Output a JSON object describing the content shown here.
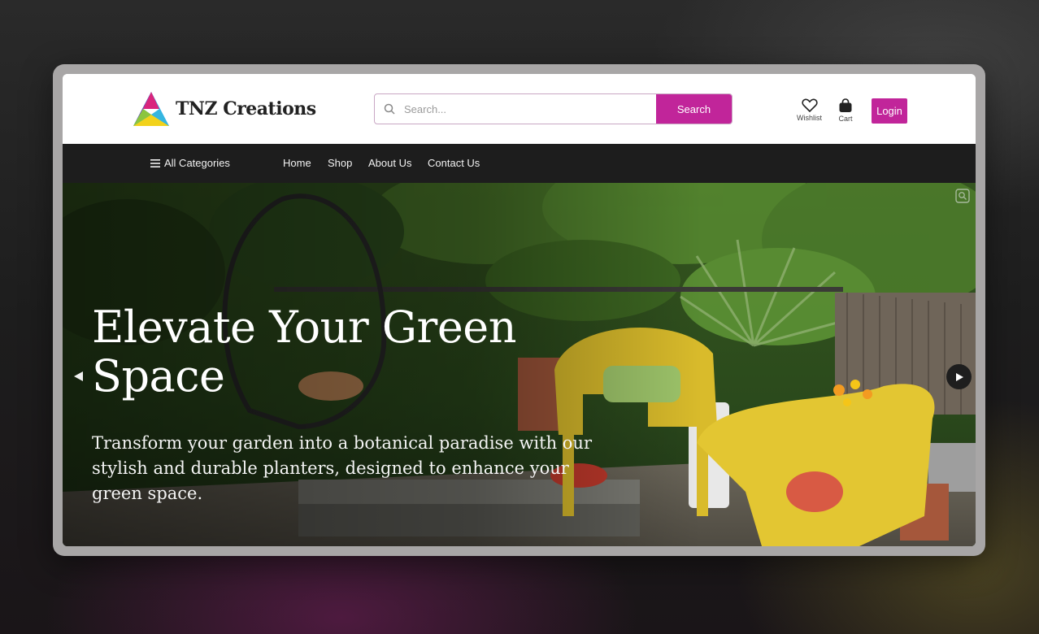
{
  "brand": {
    "name": "TNZ Creations"
  },
  "search": {
    "placeholder": "Search...",
    "button_label": "Search"
  },
  "header_actions": {
    "wishlist_label": "Wishlist",
    "cart_label": "Cart",
    "login_label": "Login"
  },
  "nav": {
    "categories_label": "All Categories",
    "links": [
      "Home",
      "Shop",
      "About Us",
      "Contact Us"
    ]
  },
  "hero": {
    "title": "Elevate Your Green Space",
    "text": "Transform your garden into a botanical paradise with our stylish and durable planters, designed to enhance your green space."
  },
  "colors": {
    "accent": "#c1259a",
    "nav_bg": "#1d1d1d"
  },
  "icons": [
    "search-icon",
    "heart-icon",
    "shopping-bag-icon",
    "menu-icon",
    "chevron-left-icon",
    "play-right-icon"
  ]
}
